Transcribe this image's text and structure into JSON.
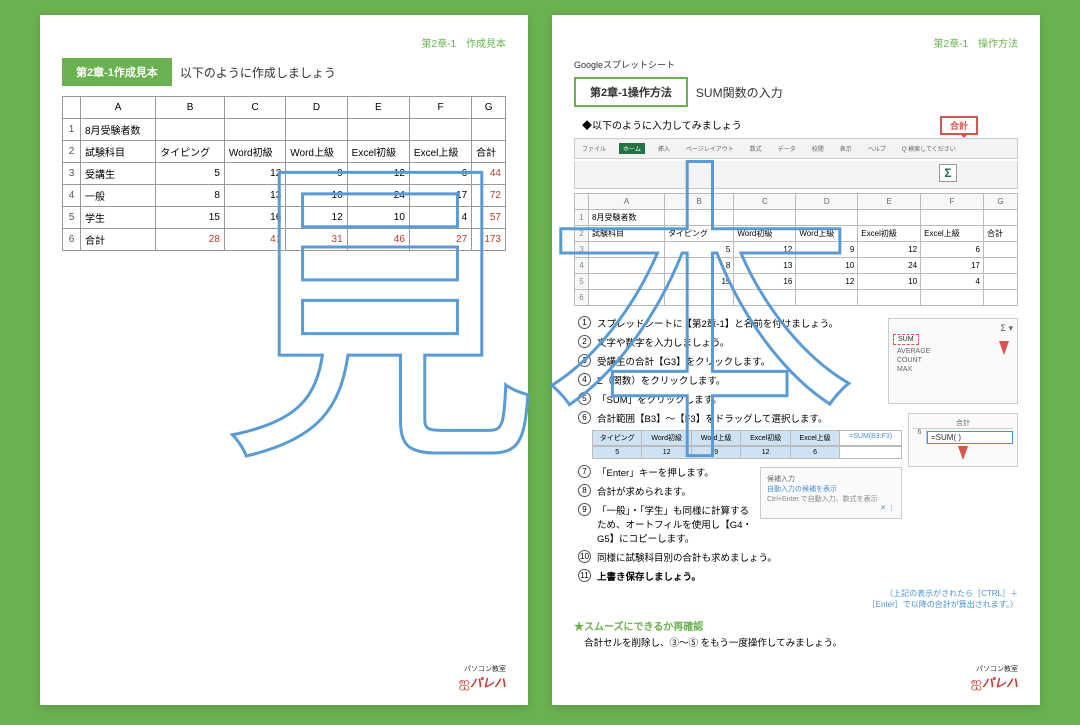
{
  "left": {
    "header_right": "第2章-1　作成見本",
    "tab": "第2章-1作成見本",
    "caption": "以下のように作成しましょう",
    "cols": [
      "",
      "A",
      "B",
      "C",
      "D",
      "E",
      "F",
      "G"
    ],
    "rows": [
      {
        "n": "1",
        "cells": [
          "8月受験者数",
          "",
          "",
          "",
          "",
          "",
          ""
        ]
      },
      {
        "n": "2",
        "cells": [
          "試験科目",
          "タイピング",
          "Word初級",
          "Word上級",
          "Excel初級",
          "Excel上級",
          "合計"
        ]
      },
      {
        "n": "3",
        "cells": [
          "受講生",
          "5",
          "12",
          "9",
          "12",
          "6",
          "44"
        ]
      },
      {
        "n": "4",
        "cells": [
          "一般",
          "8",
          "13",
          "10",
          "24",
          "17",
          "72"
        ]
      },
      {
        "n": "5",
        "cells": [
          "学生",
          "15",
          "16",
          "12",
          "10",
          "4",
          "57"
        ]
      },
      {
        "n": "6",
        "cells": [
          "合計",
          "28",
          "41",
          "31",
          "46",
          "27",
          "173"
        ]
      }
    ]
  },
  "right": {
    "header_right": "第2章-1　操作方法",
    "app_name": "Googleスプレットシート",
    "tab": "第2章-1操作方法",
    "title": "SUM関数の入力",
    "subtitle": "◆以下のように入力してみましょう",
    "sigma_label": "合計",
    "sigma": "Σ",
    "ribbon_tabs": [
      "ファイル",
      "ホーム",
      "挿入",
      "ページレイアウト",
      "数式",
      "データ",
      "校閲",
      "表示",
      "ヘルプ",
      "Q 検索してください"
    ],
    "mini_cols": [
      "",
      "A",
      "B",
      "C",
      "D",
      "E",
      "F",
      "G"
    ],
    "mini_rows": [
      {
        "n": "1",
        "cells": [
          "8月受験者数",
          "",
          "",
          "",
          "",
          "",
          ""
        ]
      },
      {
        "n": "2",
        "cells": [
          "試験科目",
          "タイピング",
          "Word初級",
          "Word上級",
          "Excel初級",
          "Excel上級",
          "合計"
        ]
      },
      {
        "n": "3",
        "cells": [
          "",
          "5",
          "12",
          "9",
          "12",
          "6",
          ""
        ]
      },
      {
        "n": "4",
        "cells": [
          "",
          "8",
          "13",
          "10",
          "24",
          "17",
          ""
        ]
      },
      {
        "n": "5",
        "cells": [
          "",
          "15",
          "16",
          "12",
          "10",
          "4",
          ""
        ]
      },
      {
        "n": "6",
        "cells": [
          "",
          "",
          "",
          "",
          "",
          "",
          ""
        ]
      }
    ],
    "steps": [
      "スプレッドシートに【第2章-1】と名前を付けましょう。",
      "文字や数字を入力しましょう。",
      "受講生の合計【G3】をクリックします。",
      "Σ（関数）をクリックします。",
      "「SUM」をクリックします。",
      "合計範囲【B3】～【F3】をドラッグして選択します。",
      "「Enter」キーを押します。",
      "合計が求められます。",
      "「一般」・「学生」も同様に計算するため、オートフィルを使用し【G4・G5】にコピーします。",
      "同様に試験科目別の合計も求めましょう。",
      "上書き保存しましょう。"
    ],
    "menu": {
      "sum": "SUM",
      "avg": "AVERAGE",
      "count": "COUNT",
      "max": "MAX"
    },
    "formula_goukei": "合計",
    "formula_row": "6",
    "formula": "=SUM(  )",
    "formula2": "=SUM(B3:F3)",
    "range_cells": [
      "タイピング",
      "Word初級",
      "Word上級",
      "Excel初級",
      "Excel上級"
    ],
    "range_vals": [
      "5",
      "12",
      "9",
      "12",
      "6"
    ],
    "hint_title": "自動入力の候補を表示",
    "hint_sub": "Ctrl+Enter で自動入力、数式を表示",
    "hint_caption1": "（上記の表示がされたら［CTRL］＋",
    "hint_caption2": "［Enter］で以降の合計が算出されます。）",
    "star": "★スムーズにできるか再確認",
    "star_sub": "合計セルを削除し、③～⑤ をもう一度操作してみましょう。"
  },
  "logo": {
    "sub": "パソコン教室",
    "main": "パレハ",
    "sym": "ஐ"
  },
  "watermark": "見本"
}
